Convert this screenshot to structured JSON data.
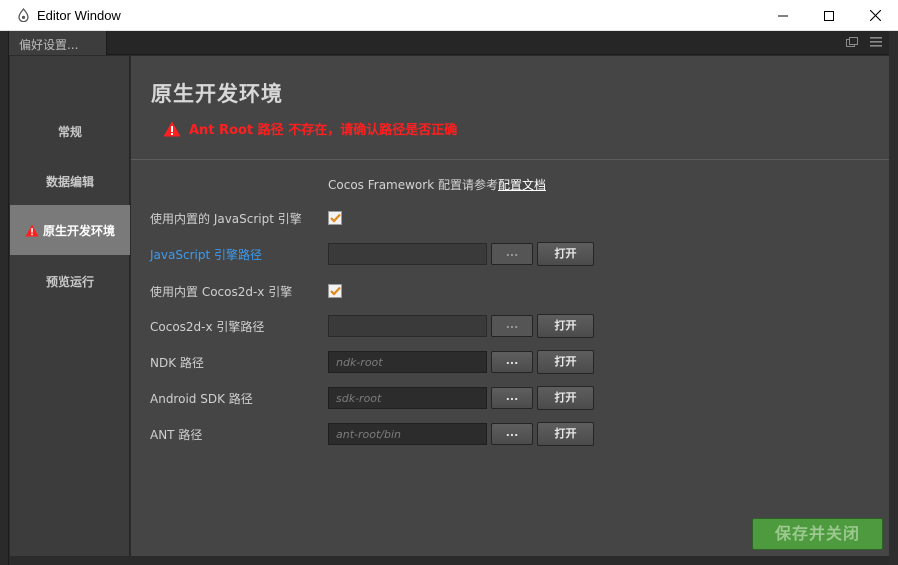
{
  "window": {
    "title": "Editor Window",
    "controls": {
      "minimize": "—",
      "maximize": "☐",
      "close": "✕"
    }
  },
  "tab": {
    "label": "偏好设置..."
  },
  "sidebar": {
    "items": [
      {
        "label": "常规",
        "active": false
      },
      {
        "label": "数据编辑",
        "active": false
      },
      {
        "label": "原生开发环境",
        "active": true,
        "warning": true
      },
      {
        "label": "预览运行",
        "active": false
      }
    ]
  },
  "page": {
    "title": "原生开发环境",
    "warning": "Ant Root 路径 不存在，请确认路径是否正确",
    "info_prefix": "Cocos Framework 配置请参考",
    "info_link": "配置文档"
  },
  "settings": {
    "use_builtin_js": {
      "label": "使用内置的 JavaScript 引擎",
      "checked": true
    },
    "js_engine_path": {
      "label": "JavaScript 引擎路径",
      "value": "",
      "placeholder": ""
    },
    "use_builtin_cocos2dx": {
      "label": "使用内置 Cocos2d-x 引擎",
      "checked": true
    },
    "cocos2dx_path": {
      "label": "Cocos2d-x 引擎路径",
      "value": "",
      "placeholder": ""
    },
    "ndk_path": {
      "label": "NDK 路径",
      "value": "",
      "placeholder": "ndk-root"
    },
    "android_sdk_path": {
      "label": "Android SDK 路径",
      "value": "",
      "placeholder": "sdk-root"
    },
    "ant_path": {
      "label": "ANT 路径",
      "value": "",
      "placeholder": "ant-root/bin"
    }
  },
  "buttons": {
    "browse": "...",
    "open": "打开",
    "save_close": "保存并关闭"
  },
  "colors": {
    "warning": "#ff1f1f",
    "link_highlight": "#3c9bf0",
    "save_button": "#4d9a3f",
    "checkmark": "#e08a1e"
  }
}
